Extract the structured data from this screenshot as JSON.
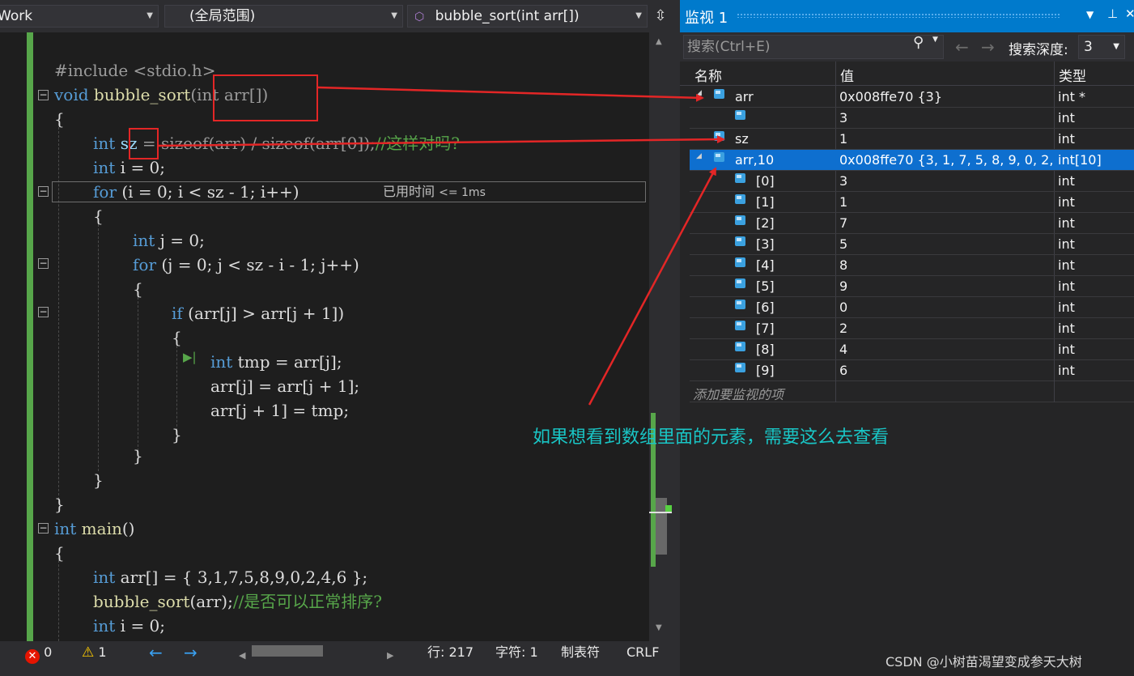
{
  "navbar": {
    "project": "Work",
    "scope": "(全局范围)",
    "function": "bubble_sort(int arr[])"
  },
  "code": {
    "line1": "#include <stdio.h>",
    "l2_kw": "void",
    "l2_fn": "bubble_sort",
    "l2_rest": "(int arr[])",
    "l3": "{",
    "l4_kw": "int",
    "l4_var": "sz",
    "l4_rest": " = sizeof(arr) / sizeof(arr[0]);",
    "l4_cm": "//这样对吗?",
    "l5_kw": "int",
    "l5_rest": " i = 0;",
    "l6_kw": "for",
    "l6_rest": " (i = 0; i < sz - 1; i++)",
    "elapsed_label": "已用时间",
    "elapsed_value": "<= 1ms",
    "l7": "{",
    "l8_kw": "int",
    "l8_rest": " j = 0;",
    "l9_kw": "for",
    "l9_rest": " (j = 0; j < sz - i - 1; j++)",
    "l10": "{",
    "l11_kw": "if",
    "l11_rest": " (arr[j] > arr[j + 1])",
    "l12": "{",
    "l13_kw": "int",
    "l13_rest": " tmp = arr[j];",
    "l14": "arr[j] = arr[j + 1];",
    "l15": "arr[j + 1] = tmp;",
    "l16": "}",
    "l17": "}",
    "l18": "}",
    "l19": "}",
    "l20_kw": "int",
    "l20_fn": " main",
    "l20_rest": "()",
    "l21": "{",
    "l22_kw": "int",
    "l22_rest": " arr[] = { 3,1,7,5,8,9,0,2,4,6 };",
    "l23_fn": "bubble_sort",
    "l23_rest": "(arr);",
    "l23_cm": "//是否可以正常排序?",
    "l24_kw": "int",
    "l24_rest": " i = 0;"
  },
  "statusbar": {
    "errors": "0",
    "warnings": "1",
    "line": "行: 217",
    "char": "字符: 1",
    "tab": "制表符",
    "eol": "CRLF"
  },
  "watch": {
    "title": "监视 1",
    "search_placeholder": "搜索(Ctrl+E)",
    "depth_label": "搜索深度:",
    "depth_value": "3",
    "col_name": "名称",
    "col_value": "值",
    "col_type": "类型",
    "rows": [
      {
        "name": "arr",
        "value": "0x008ffe70 {3}",
        "type": "int *"
      },
      {
        "name": "",
        "value": "3",
        "type": "int"
      },
      {
        "name": "sz",
        "value": "1",
        "type": "int"
      },
      {
        "name": "arr,10",
        "value": "0x008ffe70 {3, 1, 7, 5, 8, 9, 0, 2, ...",
        "type": "int[10]"
      },
      {
        "name": "[0]",
        "value": "3",
        "type": "int"
      },
      {
        "name": "[1]",
        "value": "1",
        "type": "int"
      },
      {
        "name": "[2]",
        "value": "7",
        "type": "int"
      },
      {
        "name": "[3]",
        "value": "5",
        "type": "int"
      },
      {
        "name": "[4]",
        "value": "8",
        "type": "int"
      },
      {
        "name": "[5]",
        "value": "9",
        "type": "int"
      },
      {
        "name": "[6]",
        "value": "0",
        "type": "int"
      },
      {
        "name": "[7]",
        "value": "2",
        "type": "int"
      },
      {
        "name": "[8]",
        "value": "4",
        "type": "int"
      },
      {
        "name": "[9]",
        "value": "6",
        "type": "int"
      }
    ],
    "add_item": "添加要监视的项"
  },
  "annotation": "如果想看到数组里面的元素，需要这么去查看",
  "watermark": "CSDN @小树苗渴望变成参天大树",
  "colors": {
    "accent": "#007acc",
    "annotation": "#19c6c6",
    "highlight": "#e32626"
  }
}
